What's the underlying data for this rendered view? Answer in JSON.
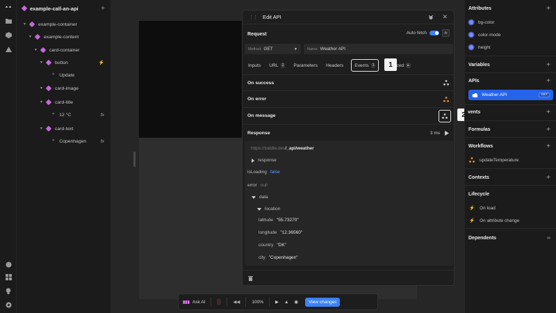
{
  "colors": {
    "accent": "#3b82f6",
    "component": "#c36ad9",
    "workflow": "#f28c38"
  },
  "rail_icons": [
    "logo-icon",
    "folder-icon",
    "package-icon",
    "warning-icon",
    "palette-icon",
    "grid-icon",
    "bulb-icon",
    "help-icon"
  ],
  "tree": {
    "title": "example-call-an-api",
    "rows": [
      {
        "label": "example-container"
      },
      {
        "label": "example-content"
      },
      {
        "label": "card-container"
      },
      {
        "label": "button"
      },
      {
        "label": "Update"
      },
      {
        "label": "card-image"
      },
      {
        "label": "card-title"
      },
      {
        "label": "12 °C",
        "right": "fx"
      },
      {
        "label": "card-text"
      },
      {
        "label": "Copenhagen",
        "right": "fx"
      }
    ]
  },
  "modal": {
    "title": "Edit API",
    "request_label": "Request",
    "auto_fetch_label": "Auto fetch",
    "fx_label": "fx",
    "method_label": "Method",
    "method_value": "GET",
    "name_label": "Name",
    "name_value": "Weather API",
    "tabs": [
      {
        "label": "Inputs"
      },
      {
        "label": "URL",
        "count": "2"
      },
      {
        "label": "Parameters"
      },
      {
        "label": "Headers"
      },
      {
        "label": "Events",
        "count": "1"
      },
      {
        "label": "ced"
      }
    ],
    "events": [
      "On success",
      "On error",
      "On message"
    ],
    "response_label": "Response",
    "response_time": "3 ms",
    "response": {
      "url_prefix": "https://toddle.dev",
      "url_path": "/_api/weather",
      "response_key": "response",
      "isloading_key": "isLoading",
      "isloading_val": "false",
      "error_key": "error",
      "error_val": "null",
      "data_key": "data",
      "location_key": "location",
      "fields": [
        {
          "key": "latitude",
          "val": "\"55.73270\""
        },
        {
          "key": "longitude",
          "val": "\"12.36560\""
        },
        {
          "key": "country",
          "val": "\"DK\""
        },
        {
          "key": "city",
          "val": "\"Copenhagen\""
        }
      ]
    }
  },
  "callouts": [
    "1",
    "2"
  ],
  "toolbar": {
    "ask_ai": "Ask AI",
    "zoom": "100%",
    "view_changes": "View changes"
  },
  "right": {
    "attributes_title": "Attributes",
    "attributes": [
      "bg-color",
      "color-mode",
      "height"
    ],
    "variables_title": "Variables",
    "apis_title": "APIs",
    "api_name": "Weather API",
    "api_method": "GET",
    "events_title": "vents",
    "formulas_title": "Formulas",
    "workflows_title": "Workflows",
    "workflow": "updateTemperature",
    "contexts_title": "Contexts",
    "lifecycle_title": "Lifecycle",
    "lifecycle": [
      "On load",
      "On attribute change"
    ],
    "dependents_title": "Dependents"
  }
}
